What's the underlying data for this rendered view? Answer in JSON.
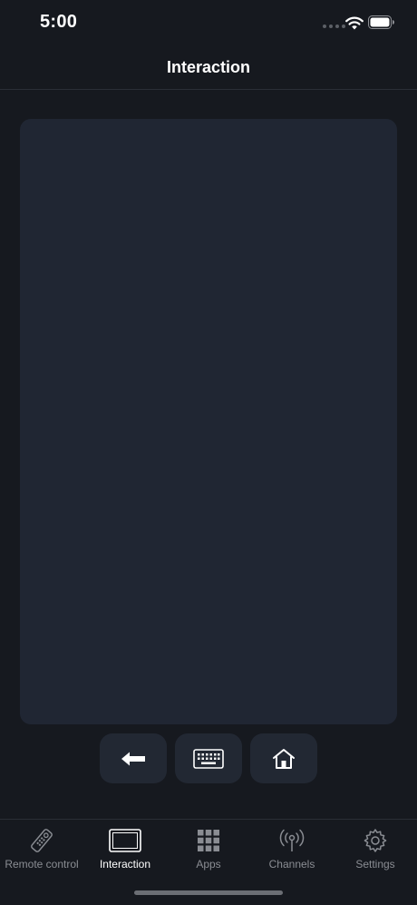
{
  "status_bar": {
    "time": "5:00",
    "icons": [
      "signal-dots-icon",
      "wifi-icon",
      "battery-icon"
    ]
  },
  "header": {
    "title": "Interaction"
  },
  "touchpad": {
    "icon": "touchpad-area"
  },
  "controls": [
    {
      "name": "back",
      "icon": "arrow-left-icon"
    },
    {
      "name": "keyboard",
      "icon": "keyboard-icon"
    },
    {
      "name": "home",
      "icon": "house-icon"
    }
  ],
  "tab_bar": {
    "items": [
      {
        "label": "Remote control",
        "icon": "remote-icon",
        "active": false
      },
      {
        "label": "Interaction",
        "icon": "screen-icon",
        "active": true
      },
      {
        "label": "Apps",
        "icon": "grid-icon",
        "active": false
      },
      {
        "label": "Channels",
        "icon": "antenna-icon",
        "active": false
      },
      {
        "label": "Settings",
        "icon": "gear-icon",
        "active": false
      }
    ]
  },
  "colors": {
    "background": "#16191f",
    "surface": "#202633",
    "button": "#222833",
    "inactive_label": "#8a8d93",
    "active_label": "#ffffff"
  }
}
